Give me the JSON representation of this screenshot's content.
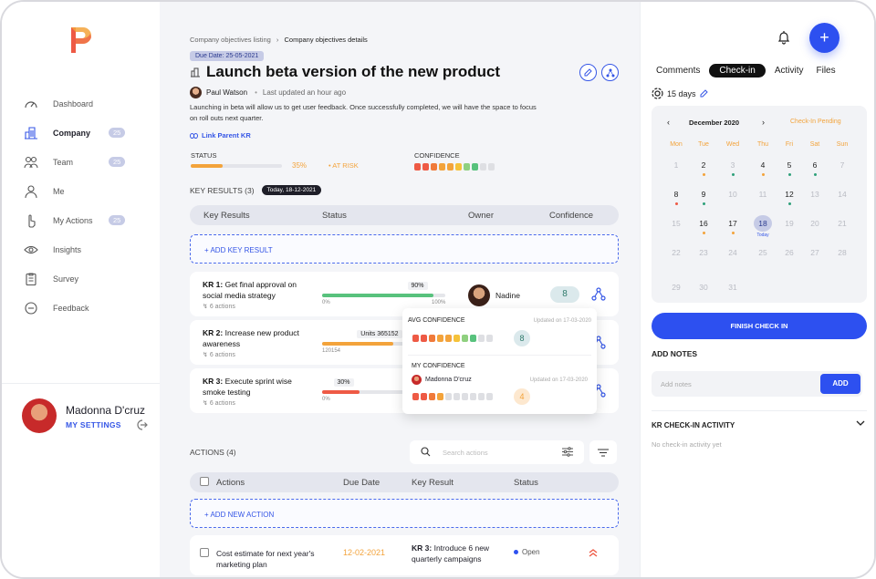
{
  "colors": {
    "accent": "#2d50f0",
    "orange": "#f3a33b",
    "green": "#58c27d",
    "red": "#ee5a45",
    "badge": "#c6cbe6"
  },
  "sidebar": {
    "items": [
      {
        "label": "Dashboard",
        "icon": "gauge-icon",
        "active": false,
        "badge": ""
      },
      {
        "label": "Company",
        "icon": "building-icon",
        "active": true,
        "badge": "25"
      },
      {
        "label": "Team",
        "icon": "team-icon",
        "active": false,
        "badge": "25"
      },
      {
        "label": "Me",
        "icon": "person-icon",
        "active": false,
        "badge": ""
      },
      {
        "label": "My Actions",
        "icon": "hand-pointer-icon",
        "active": false,
        "badge": "25"
      },
      {
        "label": "Insights",
        "icon": "eye-icon",
        "active": false,
        "badge": ""
      },
      {
        "label": "Survey",
        "icon": "clipboard-icon",
        "active": false,
        "badge": ""
      },
      {
        "label": "Feedback",
        "icon": "chat-icon",
        "active": false,
        "badge": ""
      }
    ],
    "user": {
      "name": "Madonna D'cruz",
      "settings": "MY SETTINGS"
    }
  },
  "main": {
    "breadcrumb": {
      "parent": "Company objectives listing",
      "sep": "›",
      "current": "Company objectives details"
    },
    "due_date": "Due Date:  25-05-2021",
    "title": "Launch beta version of the new product",
    "owner": "Paul Watson",
    "bullet": "•",
    "updated": "Last updated an hour ago",
    "description": "Launching in beta will allow us to get user feedback. Once successfully completed, we will have the space to focus on roll outs next quarter.",
    "link_parent": "Link Parent KR",
    "status_label": "STATUS",
    "status_pct": "35%",
    "status_progress": 0.35,
    "status_text": "AT RISK",
    "confidence_label": "CONFIDENCE",
    "confidence_squares": [
      "#ee5a45",
      "#ee5a45",
      "#f07a3a",
      "#f3a33b",
      "#f3a33b",
      "#f5c23a",
      "#8fd07f",
      "#58c27d",
      "#dedfe3",
      "#dedfe3"
    ],
    "key_results_title": "KEY RESULTS (3)",
    "today_badge": "Today, 18-12-2021",
    "kr_headers": {
      "kr": "Key Results",
      "status": "Status",
      "owner": "Owner",
      "confidence": "Confidence"
    },
    "add_kr": "+ ADD KEY RESULT",
    "krs": [
      {
        "prefix": "KR 1:",
        "text": "Get final approval on social media strategy",
        "actions": "6 actions",
        "progress": 0.9,
        "tag": "90%",
        "min": "0%",
        "max": "100%",
        "color": "#58c27d",
        "owner": "Nadine",
        "confidence": "8"
      },
      {
        "prefix": "KR 2:",
        "text": "Increase new product awareness",
        "actions": "6 actions",
        "progress": 0.58,
        "tag": "Units 365152",
        "min": "120154",
        "max": "",
        "color": "#f3a33b",
        "owner": "",
        "confidence": ""
      },
      {
        "prefix": "KR 3:",
        "text": "Execute sprint wise smoke testing",
        "actions": "6 actions",
        "progress": 0.3,
        "tag": "30%",
        "min": "0%",
        "max": "",
        "color": "#ee5a45",
        "owner": "",
        "confidence": ""
      }
    ],
    "popup": {
      "avg_label": "AVG CONFIDENCE",
      "avg_updated": "Updated on 17-03-2020",
      "avg_value": "8",
      "avg_squares": [
        "#ee5a45",
        "#ee5a45",
        "#f07a3a",
        "#f3a33b",
        "#f3a33b",
        "#f5c23a",
        "#8fd07f",
        "#58c27d",
        "#dedfe3",
        "#dedfe3"
      ],
      "my_label": "MY CONFIDENCE",
      "my_user": "Madonna D'cruz",
      "my_updated": "Updated on 17-03-2020",
      "my_value": "4",
      "my_squares": [
        "#ee5a45",
        "#ee5a45",
        "#f07a3a",
        "#f3a33b",
        "#dedfe3",
        "#dedfe3",
        "#dedfe3",
        "#dedfe3",
        "#dedfe3",
        "#dedfe3"
      ]
    },
    "actions_title": "ACTIONS (4)",
    "search_placeholder": "Search actions",
    "action_headers": {
      "actions": "Actions",
      "due": "Due Date",
      "kr": "Key Result",
      "status": "Status"
    },
    "add_action": "+ ADD NEW ACTION",
    "action_row": {
      "title": "Cost estimate for next year's marketing plan",
      "due": "12-02-2021",
      "kr_prefix": "KR 3:",
      "kr_text": "Introduce 6 new quarterly campaigns",
      "status": "Open"
    }
  },
  "right": {
    "tabs": [
      "Comments",
      "Check-in",
      "Activity",
      "Files"
    ],
    "active_tab": "Check-in",
    "days": "15 days",
    "calendar": {
      "prev": "‹",
      "next": "›",
      "month": "December 2020",
      "pending": "Check-In Pending",
      "dow": [
        "Mon",
        "Tue",
        "Wed",
        "Thu",
        "Fri",
        "Sat",
        "Sun"
      ],
      "weeks": [
        [
          {
            "d": "1",
            "s": "muted"
          },
          {
            "d": "2",
            "s": "dark",
            "m": "#f3a33b"
          },
          {
            "d": "3",
            "s": "muted",
            "m": "#2fa07a"
          },
          {
            "d": "4",
            "s": "dark",
            "m": "#f3a33b"
          },
          {
            "d": "5",
            "s": "dark",
            "m": "#2fa07a"
          },
          {
            "d": "6",
            "s": "dark",
            "m": "#2fa07a"
          },
          {
            "d": "7",
            "s": "muted"
          }
        ],
        [
          {
            "d": "8",
            "s": "dark",
            "m": "#ee5a45"
          },
          {
            "d": "9",
            "s": "dark",
            "m": "#2fa07a"
          },
          {
            "d": "10",
            "s": "muted"
          },
          {
            "d": "11",
            "s": "muted"
          },
          {
            "d": "12",
            "s": "dark",
            "m": "#2fa07a"
          },
          {
            "d": "13",
            "s": "muted"
          },
          {
            "d": "14",
            "s": "muted"
          }
        ],
        [
          {
            "d": "15",
            "s": "muted"
          },
          {
            "d": "16",
            "s": "dark",
            "m": "#f3a33b"
          },
          {
            "d": "17",
            "s": "dark",
            "m": "#f3a33b"
          },
          {
            "d": "18",
            "s": "today"
          },
          {
            "d": "19",
            "s": "muted"
          },
          {
            "d": "20",
            "s": "muted"
          },
          {
            "d": "21",
            "s": "muted"
          }
        ],
        [
          {
            "d": "22",
            "s": "muted"
          },
          {
            "d": "23",
            "s": "muted"
          },
          {
            "d": "24",
            "s": "muted"
          },
          {
            "d": "25",
            "s": "muted"
          },
          {
            "d": "26",
            "s": "muted"
          },
          {
            "d": "27",
            "s": "muted"
          },
          {
            "d": "28",
            "s": "muted"
          }
        ],
        [
          {
            "d": "29",
            "s": "muted"
          },
          {
            "d": "30",
            "s": "muted"
          },
          {
            "d": "31",
            "s": "muted"
          }
        ]
      ],
      "today_label": "Today"
    },
    "finish_button": "FINISH CHECK IN",
    "add_notes_label": "ADD NOTES",
    "notes_placeholder": "Add notes",
    "add_button": "ADD",
    "activity_title": "KR CHECK-IN ACTIVITY",
    "activity_empty": "No check-in activity yet"
  }
}
